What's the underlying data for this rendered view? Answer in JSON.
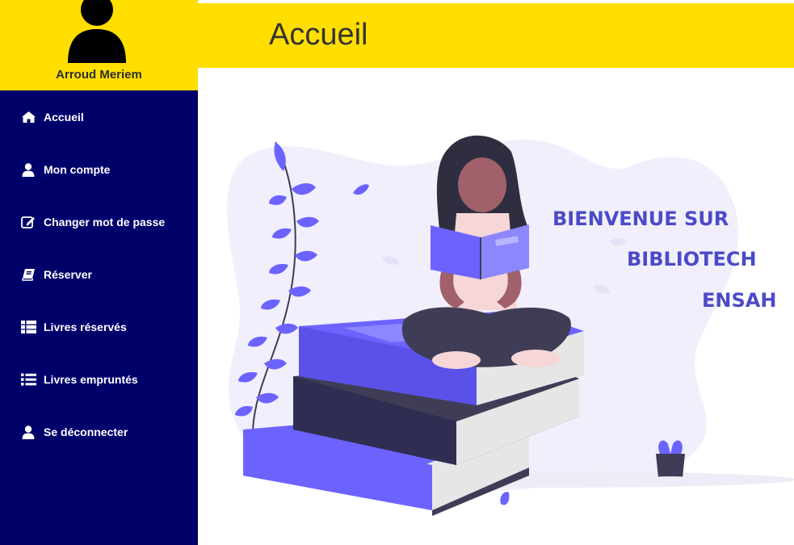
{
  "user": {
    "name": "Arroud Meriem"
  },
  "header": {
    "title": "Accueil"
  },
  "sidebar": {
    "items": [
      {
        "label": "Accueil",
        "icon": "home-icon"
      },
      {
        "label": "Mon compte",
        "icon": "user-icon"
      },
      {
        "label": "Changer mot de passe",
        "icon": "edit-icon"
      },
      {
        "label": "Réserver",
        "icon": "book-icon"
      },
      {
        "label": "Livres réservés",
        "icon": "th-list-icon"
      },
      {
        "label": "Livres empruntés",
        "icon": "list-icon"
      },
      {
        "label": "Se déconnecter",
        "icon": "user-icon"
      }
    ]
  },
  "main": {
    "welcome": [
      "BIENVENUE SUR",
      "BIBLIOTECH",
      "ENSAH"
    ]
  },
  "colors": {
    "header_bg": "#FFDE00",
    "sidebar_bg": "#00006B",
    "accent": "#6C63FF",
    "welcome_text": "#4B4BC8"
  }
}
